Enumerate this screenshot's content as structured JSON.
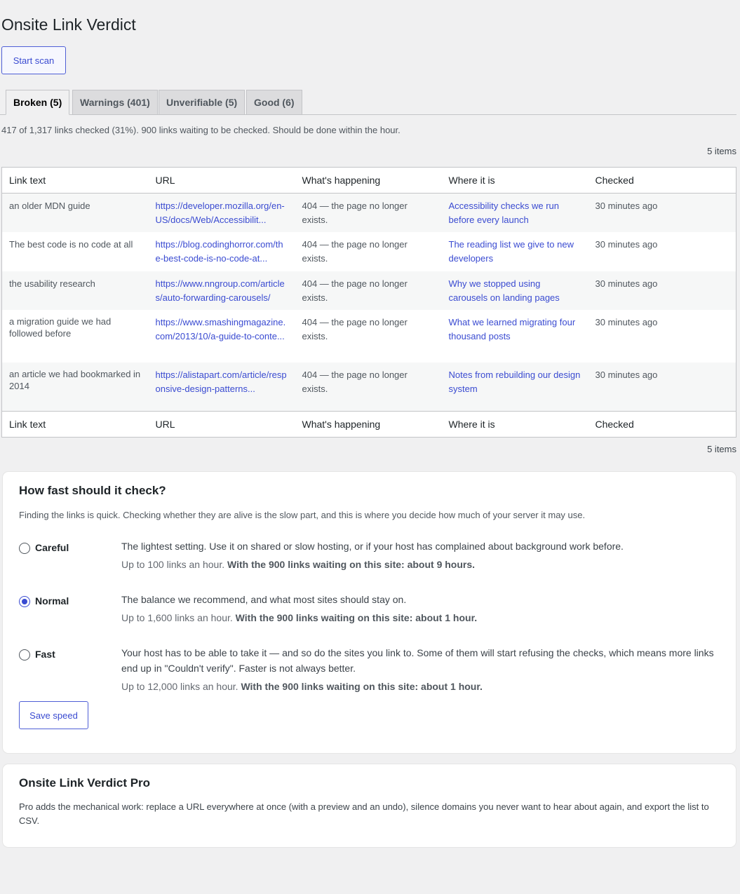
{
  "page": {
    "title": "Onsite Link Verdict",
    "start_scan_label": "Start scan"
  },
  "tabs": [
    {
      "label": "Broken (5)"
    },
    {
      "label": "Warnings (401)"
    },
    {
      "label": "Unverifiable (5)"
    },
    {
      "label": "Good (6)"
    }
  ],
  "status": {
    "progress_text": "417 of 1,317 links checked (31%). 900 links waiting to be checked. Should be done within the hour.",
    "items_count": "5 items"
  },
  "table": {
    "columns": [
      "Link text",
      "URL",
      "What's happening",
      "Where it is",
      "Checked"
    ],
    "rows": [
      {
        "link_text": "an older MDN guide",
        "url": "https://developer.mozilla.org/en-US/docs/Web/Accessibilit...",
        "status": "404 — the page no longer exists.",
        "where": "Accessibility checks we run before every launch",
        "checked": "30 minutes ago"
      },
      {
        "link_text": "The best code is no code at all",
        "url": "https://blog.codinghorror.com/the-best-code-is-no-code-at...",
        "status": "404 — the page no longer exists.",
        "where": "The reading list we give to new developers",
        "checked": "30 minutes ago"
      },
      {
        "link_text": "the usability research",
        "url": "https://www.nngroup.com/articles/auto-forwarding-carousels/",
        "status": "404 — the page no longer exists.",
        "where": "Why we stopped using carousels on landing pages",
        "checked": "30 minutes ago"
      },
      {
        "link_text": "a migration guide we had followed before",
        "url": "https://www.smashingmagazine.com/2013/10/a-guide-to-conte...",
        "status": "404 — the page no longer exists.",
        "where": "What we learned migrating four thousand posts",
        "checked": "30 minutes ago"
      },
      {
        "link_text": "an article we had bookmarked in 2014",
        "url": "https://alistapart.com/article/responsive-design-patterns...",
        "status": "404 — the page no longer exists.",
        "where": "Notes from rebuilding our design system",
        "checked": "30 minutes ago"
      }
    ]
  },
  "speed": {
    "heading": "How fast should it check?",
    "intro": "Finding the links is quick. Checking whether they are alive is the slow part, and this is where you decide how much of your server it may use.",
    "selected": "Normal",
    "options": [
      {
        "label": "Careful",
        "description": "The lightest setting. Use it on shared or slow hosting, or if your host has complained about background work before.",
        "rate": "Up to 100 links an hour.",
        "estimate": "With the 900 links waiting on this site: about 9 hours."
      },
      {
        "label": "Normal",
        "description": "The balance we recommend, and what most sites should stay on.",
        "rate": "Up to 1,600 links an hour.",
        "estimate": "With the 900 links waiting on this site: about 1 hour."
      },
      {
        "label": "Fast",
        "description": "Your host has to be able to take it — and so do the sites you link to. Some of them will start refusing the checks, which means more links end up in \"Couldn't verify\". Faster is not always better.",
        "rate": "Up to 12,000 links an hour.",
        "estimate": "With the 900 links waiting on this site: about 1 hour."
      }
    ],
    "save_label": "Save speed"
  },
  "pro": {
    "heading": "Onsite Link Verdict Pro",
    "text": "Pro adds the mechanical work: replace a URL everywhere at once (with a preview and an undo), silence domains you never want to hear about again, and export the list to CSV."
  }
}
